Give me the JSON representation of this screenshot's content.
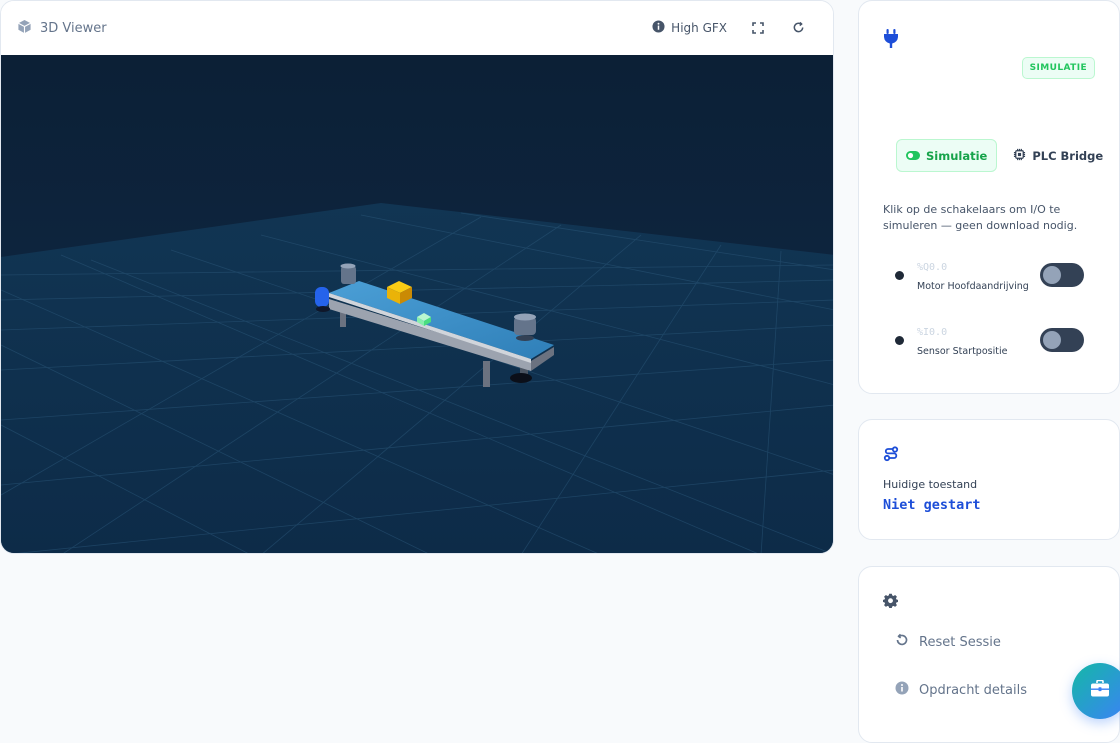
{
  "viewer": {
    "title": "3D Viewer",
    "quality_label": "High GFX",
    "icons": [
      "cube-icon",
      "info-icon",
      "fullscreen-icon",
      "refresh-icon"
    ]
  },
  "connection": {
    "status_badge": "SIMULATIE",
    "modes": [
      {
        "label": "Simulatie",
        "active": true
      },
      {
        "label": "PLC Bridge",
        "active": false
      }
    ],
    "hint": "Klik op de schakelaars om I/O te simuleren — geen download nodig.",
    "io": [
      {
        "address": "%Q0.0",
        "label": "Motor Hoofdaandrijving",
        "on": false
      },
      {
        "address": "%I0.0",
        "label": "Sensor Startpositie",
        "on": false
      }
    ]
  },
  "state": {
    "label": "Huidige toestand",
    "value": "Niet gestart"
  },
  "settings": {
    "items": [
      {
        "label": "Reset Sessie",
        "icon": "reset-icon"
      },
      {
        "label": "Opdracht details",
        "icon": "info-icon"
      }
    ]
  },
  "colors": {
    "accent_green": "#22c55e",
    "accent_blue": "#1d4ed8",
    "scene_background": "#0b2038"
  }
}
